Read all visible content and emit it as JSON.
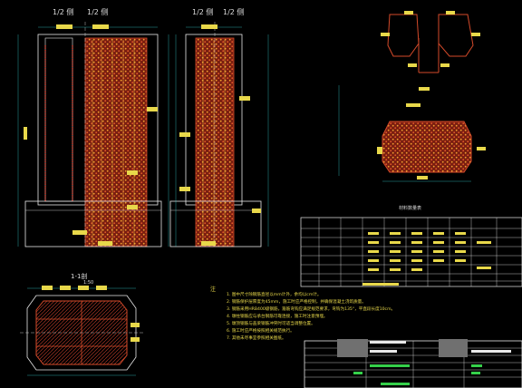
{
  "views": {
    "elev_left_a": "1/2 侧",
    "elev_left_b": "1/2 侧",
    "elev_right_a": "1/2 侧",
    "elev_right_b": "1/2 侧",
    "section": "1-1剖",
    "section_scale": "1:50"
  },
  "table": {
    "title": "材料数量表"
  },
  "notes": {
    "heading": "注",
    "items": [
      "1. 图中尺寸除钢筋直径以mm计外，余均以cm计。",
      "2. 钢筋保护层厚度为45mm，施工时应严格控制，并确保混凝土浇筑质量。",
      "3. 钢筋采用HRB400级钢筋，箍筋弯钩应满足规范要求，弯钩为135°，平直段长度10cm。",
      "4. 墩柱钢筋应与承台钢筋可靠连接，施工时注意预埋。",
      "5. 墩顶钢筋与盖梁钢筋冲突时可适当调整位置。",
      "6. 施工时应严格按照相关规范执行。",
      "7. 其他未尽事宜参照相关图纸。"
    ]
  },
  "colors": {
    "background": "#000000",
    "frame": "#e8e8e8",
    "rebar": "#d44a2a",
    "rebar_dot": "#f0c040",
    "dim": "#35c8c8",
    "text": "#e8d84a",
    "titleblock_green": "#35d04a"
  }
}
